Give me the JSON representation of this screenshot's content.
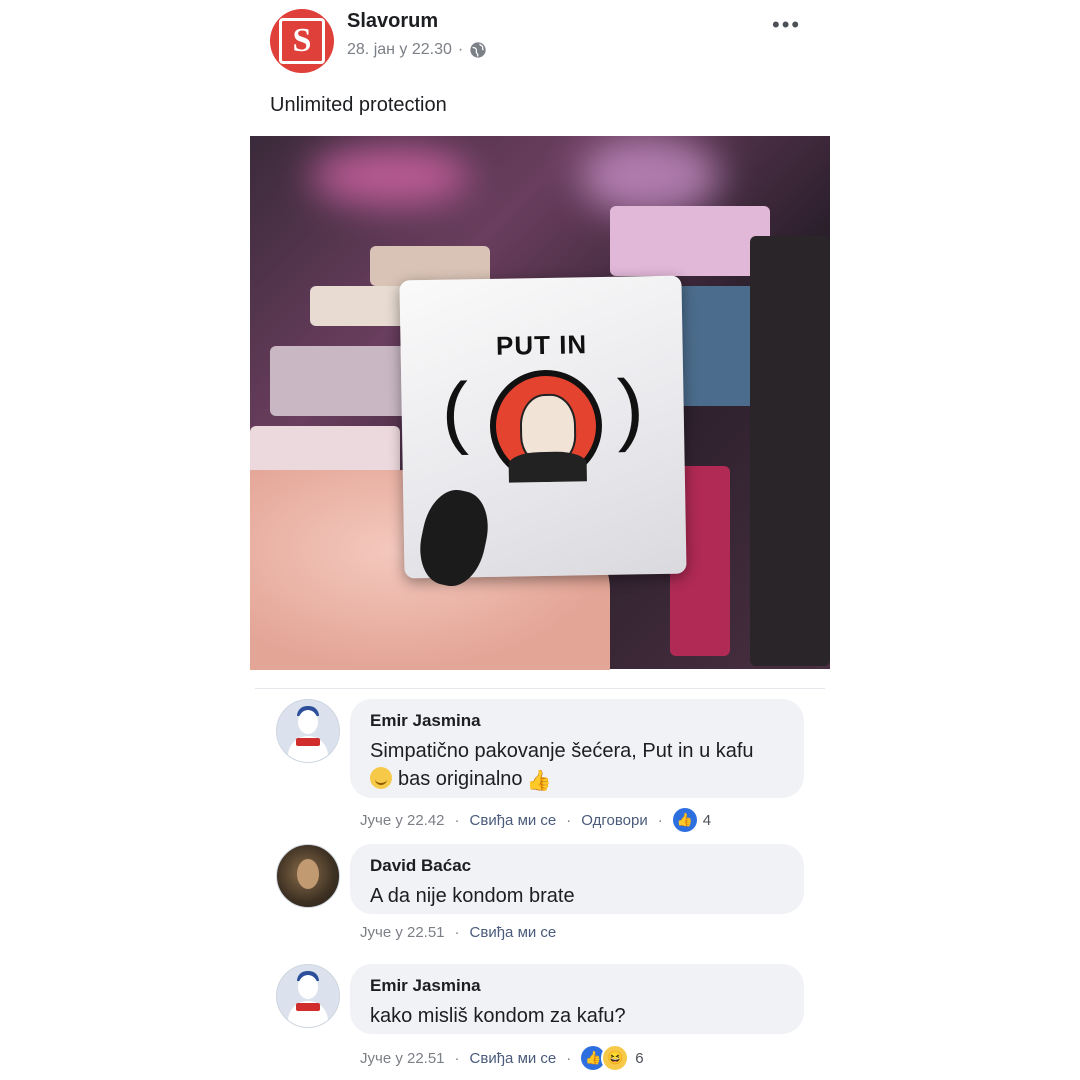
{
  "post": {
    "page_name": "Slavorum",
    "timestamp": "28. јан у 22.30",
    "separator": "·",
    "more_label": "•••",
    "text": "Unlimited protection",
    "packet_title": "PUT IN"
  },
  "comments": [
    {
      "name": "Emir Jasmina",
      "text_line1": "Simpatično pakovanje šećera, Put in u kafu",
      "text_line2": "bas originalno",
      "time": "Јуче у 22.42",
      "like": "Свиђа ми се",
      "reply": "Одговори",
      "reaction_count": "4"
    },
    {
      "name": "David Baćac",
      "text_line1": "A da nije kondom brate",
      "time": "Јуче у 22.51",
      "like": "Свиђа ми се"
    },
    {
      "name": "Emir Jasmina",
      "text_line1": "kako misliš kondom za kafu?",
      "time": "Јуче у 22.51",
      "like": "Свиђа ми се",
      "reaction_count": "6"
    }
  ],
  "colors": {
    "page_avatar": "#e0403a",
    "link": "#4b5b7c",
    "bubble": "#f0f2f5",
    "like_reaction": "#2e6fe0",
    "haha_reaction": "#f7c948"
  },
  "icons": {
    "privacy": "globe-icon",
    "menu": "more-icon",
    "reaction_like": "like-reaction-icon",
    "reaction_haha": "haha-reaction-icon"
  }
}
